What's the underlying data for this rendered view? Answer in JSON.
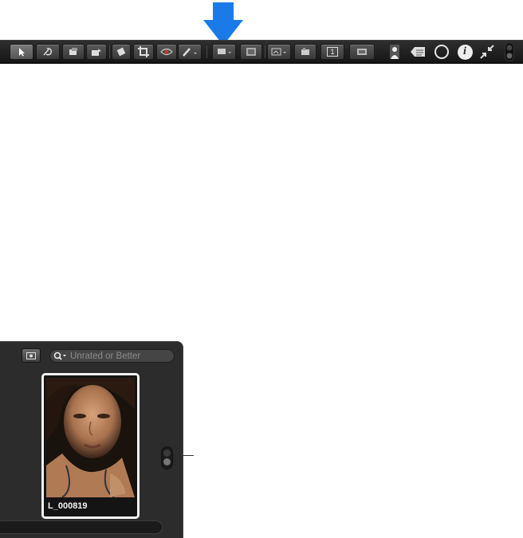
{
  "toolbar": {
    "tools": [
      {
        "name": "selection-tool",
        "icon": "arrow-pointer-icon",
        "selected": true
      },
      {
        "name": "straighten-tool",
        "icon": "straighten-icon"
      },
      {
        "name": "lift-tool",
        "icon": "lift-icon"
      },
      {
        "name": "stamp-tool",
        "icon": "stamp-icon"
      },
      {
        "name": "rotate-tool",
        "icon": "rotate-icon"
      },
      {
        "name": "crop-tool",
        "icon": "crop-icon"
      },
      {
        "name": "red-eye-tool",
        "icon": "eye-icon"
      },
      {
        "name": "brush-tool",
        "icon": "brush-icon"
      }
    ],
    "layout_buttons": [
      {
        "name": "browser-layout",
        "icon": "monitor-icon"
      },
      {
        "name": "filmstrip-layout",
        "icon": "filmstrip-icon"
      },
      {
        "name": "viewer-mode",
        "icon": "viewer-icon"
      },
      {
        "name": "multi-view",
        "icon": "multi-view-icon"
      },
      {
        "name": "single-image",
        "icon": "single-image-icon",
        "label": "1"
      },
      {
        "name": "full-screen",
        "icon": "full-screen-icon"
      }
    ],
    "right_buttons": [
      {
        "name": "faces",
        "icon": "person-icon"
      },
      {
        "name": "keywords",
        "icon": "tag-icon"
      },
      {
        "name": "loupe",
        "icon": "loupe-icon"
      },
      {
        "name": "info",
        "icon": "info-icon",
        "label": "i"
      },
      {
        "name": "shrink",
        "icon": "shrink-icon"
      }
    ]
  },
  "browser": {
    "search_placeholder": "Unrated or Better",
    "photo_name": "L_000819"
  },
  "colors": {
    "callout": "#1a7be8",
    "toolbar": "#222222",
    "panel": "#2c2c2c"
  }
}
